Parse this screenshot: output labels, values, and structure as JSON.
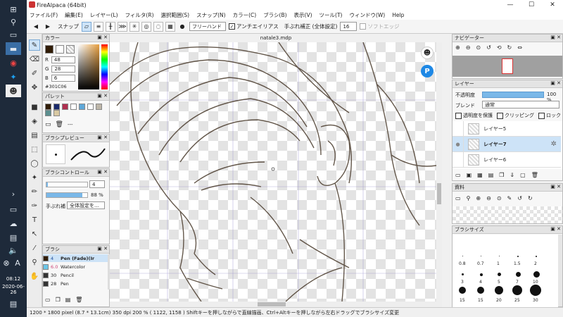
{
  "taskbar": {
    "time": "08:12",
    "date": "2020-06-26"
  },
  "app": {
    "title": "FireAlpaca (64bit)",
    "menu": [
      "ファイル(F)",
      "編集(E)",
      "レイヤー(L)",
      "フィルタ(R)",
      "選択範囲(S)",
      "スナップ(N)",
      "カラー(C)",
      "ブラシ(B)",
      "表示(V)",
      "ツール(T)",
      "ウィンドウ(W)",
      "Help"
    ]
  },
  "toolbar": {
    "snap_label": "スナップ",
    "mode_value": "フリーハンド",
    "antialias_label": "アンチエイリアス",
    "stabilizer_label": "手ぶれ補正 (全体設定)",
    "stabilizer_value": "16",
    "soft_edge_label": "ソフトエッジ"
  },
  "panels": {
    "color": {
      "title": "カラー",
      "r_label": "R",
      "r_value": "48",
      "g_label": "G",
      "g_value": "28",
      "b_label": "B",
      "b_value": "6",
      "hex": "#301C06",
      "current_color": "#301c06"
    },
    "palette": {
      "title": "パレット",
      "colors": [
        "#301c06",
        "#1a2a6c",
        "#b03050",
        "#ffffff",
        "#5fa8d8",
        "#ffffff",
        "#bdb6a8",
        "#5c8f8f",
        "#d9c9a3"
      ],
      "dash": "---"
    },
    "brush_preview": {
      "title": "ブラシプレビュー"
    },
    "brush_control": {
      "title": "ブラシコントロール",
      "size_value": "4",
      "opacity_value": "88 %",
      "stabilizer_label": "手ぶれ補",
      "stabilizer_value": "全体設定を…"
    },
    "brush": {
      "title": "ブラシ",
      "items": [
        {
          "size": "4",
          "name": "Pen (Fade)(Ir"
        },
        {
          "size": "6.0",
          "name": "Watercolor"
        },
        {
          "size": "30",
          "name": "Pencil"
        },
        {
          "size": "28",
          "name": "Pen"
        }
      ]
    },
    "navigator": {
      "title": "ナビゲーター"
    },
    "layer": {
      "title": "レイヤー",
      "opacity_label": "不透明度",
      "opacity_value": "100 %",
      "blend_label": "ブレンド",
      "blend_value": "通常",
      "protect_alpha": "透明度を保護",
      "clipping": "クリッピング",
      "lock": "ロック",
      "layers": [
        "レイヤー5",
        "レイヤー7",
        "レイヤー6"
      ]
    },
    "materials": {
      "title": "資料"
    },
    "brush_size": {
      "title": "ブラシサイズ",
      "labels_row1": [
        "0.8",
        "0.7",
        "1",
        "1.5",
        "2"
      ],
      "labels_row2": [
        "3",
        "4",
        "5",
        "7",
        "10"
      ],
      "labels_row3": [
        "15",
        "15",
        "20",
        "25",
        "30"
      ]
    }
  },
  "canvas": {
    "tab": "natale3.mdp"
  },
  "status": {
    "text": "1200 * 1800 pixel  (8.7 * 13.1cm)  350 dpi  200 %  ( 1122, 1158 )  Shiftキーを押しながらで直線描画、Ctrl+Altキーを押しながら左右ドラッグでブラシサイズ変更"
  }
}
